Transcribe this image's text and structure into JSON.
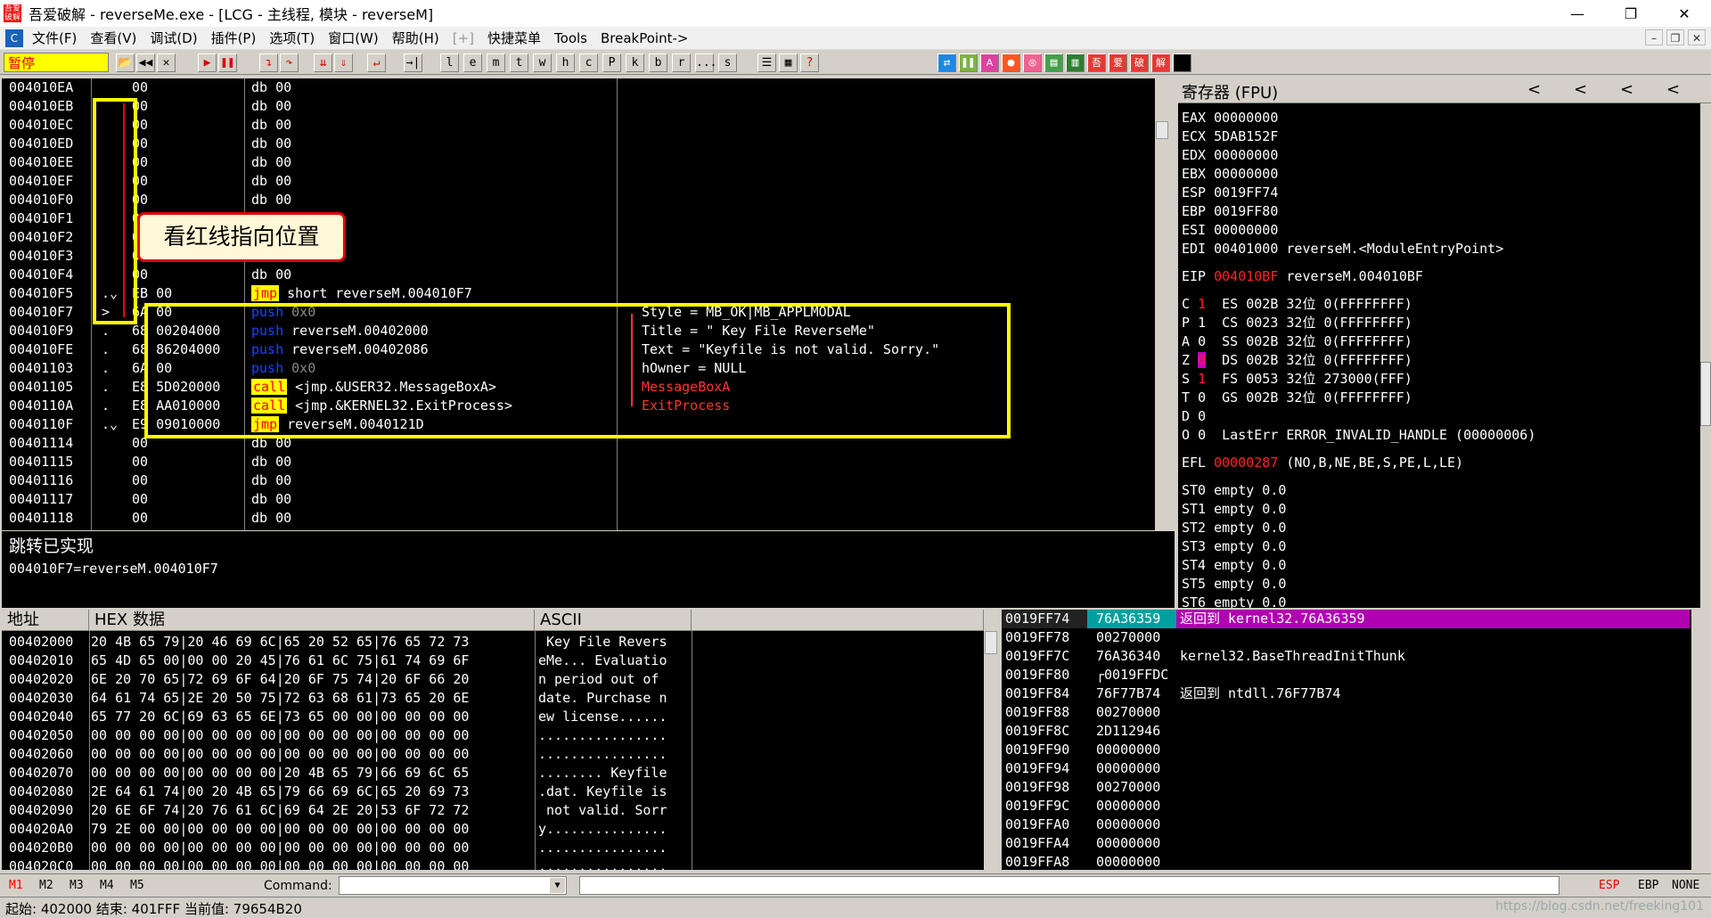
{
  "window": {
    "title": "吾爱破解 - reverseMe.exe - [LCG - 主线程, 模块 - reverseM]",
    "app_icon": "吾爱破解",
    "minimize": "—",
    "restore": "❐",
    "close": "✕"
  },
  "menu": {
    "items": [
      "文件(F)",
      "查看(V)",
      "调试(D)",
      "插件(P)",
      "选项(T)",
      "窗口(W)",
      "帮助(H)",
      "[+]",
      "快捷菜单",
      "Tools",
      "BreakPoint->"
    ]
  },
  "toolbar": {
    "status": "暂停",
    "letters": [
      "l",
      "e",
      "m",
      "t",
      "w",
      "h",
      "c",
      "P",
      "k",
      "b",
      "r",
      "...",
      "s"
    ],
    "right_icons": [
      "吾",
      "爱",
      "破",
      "解"
    ]
  },
  "cpu": {
    "rows": [
      {
        "addr": "004010EA",
        "mark": "",
        "hex": "00",
        "dis": "db 00",
        "com": ""
      },
      {
        "addr": "004010EB",
        "mark": "",
        "hex": "00",
        "dis": "db 00",
        "com": ""
      },
      {
        "addr": "004010EC",
        "mark": "",
        "hex": "00",
        "dis": "db 00",
        "com": ""
      },
      {
        "addr": "004010ED",
        "mark": "",
        "hex": "00",
        "dis": "db 00",
        "com": ""
      },
      {
        "addr": "004010EE",
        "mark": "",
        "hex": "00",
        "dis": "db 00",
        "com": ""
      },
      {
        "addr": "004010EF",
        "mark": "",
        "hex": "00",
        "dis": "db 00",
        "com": ""
      },
      {
        "addr": "004010F0",
        "mark": "",
        "hex": "00",
        "dis": "db 00",
        "com": ""
      },
      {
        "addr": "004010F1",
        "mark": "",
        "hex": "00",
        "dis": "db 00",
        "com": ""
      },
      {
        "addr": "004010F2",
        "mark": "",
        "hex": "00",
        "dis": "db 00",
        "com": ""
      },
      {
        "addr": "004010F3",
        "mark": "",
        "hex": "00",
        "dis": "db 00",
        "com": ""
      },
      {
        "addr": "004010F4",
        "mark": "",
        "hex": "00",
        "dis": "db 00",
        "com": ""
      },
      {
        "addr": "004010F5",
        "mark": ".⌄",
        "hex": "EB 00",
        "kw": "jmp",
        "operand": "short reverseM.004010F7",
        "com": ""
      },
      {
        "addr": "004010F7",
        "mark": ">",
        "hex": "6A 00",
        "kwb": "push",
        "operand": "0x0",
        "dim": true,
        "com": "Style = MB_OK|MB_APPLMODAL"
      },
      {
        "addr": "004010F9",
        "mark": ".",
        "hex": "68 00204000",
        "kwb": "push",
        "operand": "reverseM.00402000",
        "com": "Title = \" Key File ReverseMe\""
      },
      {
        "addr": "004010FE",
        "mark": ".",
        "hex": "68 86204000",
        "kwb": "push",
        "operand": "reverseM.00402086",
        "com": "Text = \"Keyfile is not valid. Sorry.\""
      },
      {
        "addr": "00401103",
        "mark": ".",
        "hex": "6A 00",
        "kwb": "push",
        "operand": "0x0",
        "dim": true,
        "com": "hOwner = NULL"
      },
      {
        "addr": "00401105",
        "mark": ".",
        "hex": "E8 5D020000",
        "kw": "call",
        "operand": "<jmp.&USER32.MessageBoxA>",
        "com": "MessageBoxA",
        "com_red": true
      },
      {
        "addr": "0040110A",
        "mark": ".",
        "hex": "E8 AA010000",
        "kw": "call",
        "operand": "<jmp.&KERNEL32.ExitProcess>",
        "com": "ExitProcess",
        "com_red": true
      },
      {
        "addr": "0040110F",
        "mark": ".⌄",
        "hex": "E9 09010000",
        "kw": "jmp",
        "operand": "reverseM.0040121D",
        "com": ""
      },
      {
        "addr": "00401114",
        "mark": "",
        "hex": "00",
        "dis": "db 00",
        "com": ""
      },
      {
        "addr": "00401115",
        "mark": "",
        "hex": "00",
        "dis": "db 00",
        "com": ""
      },
      {
        "addr": "00401116",
        "mark": "",
        "hex": "00",
        "dis": "db 00",
        "com": ""
      },
      {
        "addr": "00401117",
        "mark": "",
        "hex": "00",
        "dis": "db 00",
        "com": ""
      },
      {
        "addr": "00401118",
        "mark": "",
        "hex": "00",
        "dis": "db 00",
        "com": ""
      }
    ]
  },
  "callout": "看红线指向位置",
  "info": {
    "title": "跳转已实现",
    "detail": "004010F7=reverseM.004010F7"
  },
  "registers": {
    "header": "寄存器 (FPU)",
    "arrows": [
      "<",
      "<",
      "<",
      "<"
    ],
    "gp": [
      "EAX 00000000",
      "ECX 5DAB152F",
      "EDX 00000000",
      "EBX 00000000",
      "ESP 0019FF74",
      "EBP 0019FF80",
      "ESI 00000000",
      "EDI 00401000 reverseM.<ModuleEntryPoint>"
    ],
    "eip_label": "EIP",
    "eip_value": "004010BF",
    "eip_comment": "reverseM.004010BF",
    "flags": [
      {
        "f": "C",
        "v": "1",
        "red": true,
        "seg": "ES 002B 32位 0(FFFFFFFF)"
      },
      {
        "f": "P",
        "v": "1",
        "red": false,
        "seg": "CS 0023 32位 0(FFFFFFFF)"
      },
      {
        "f": "A",
        "v": "0",
        "red": false,
        "seg": "SS 002B 32位 0(FFFFFFFF)"
      },
      {
        "f": "Z",
        "v": "0",
        "red": true,
        "zf": true,
        "seg": "DS 002B 32位 0(FFFFFFFF)"
      },
      {
        "f": "S",
        "v": "1",
        "red": true,
        "seg": "FS 0053 32位 273000(FFF)"
      },
      {
        "f": "T",
        "v": "0",
        "red": false,
        "seg": "GS 002B 32位 0(FFFFFFFF)"
      },
      {
        "f": "D",
        "v": "0",
        "red": false,
        "seg": ""
      },
      {
        "f": "O",
        "v": "0",
        "red": false,
        "seg": "LastErr ERROR_INVALID_HANDLE (00000006)"
      }
    ],
    "efl_label": "EFL",
    "efl_value": "00000287",
    "efl_comment": "(NO,B,NE,BE,S,PE,L,LE)",
    "fpu": [
      "ST0 empty 0.0",
      "ST1 empty 0.0",
      "ST2 empty 0.0",
      "ST3 empty 0.0",
      "ST4 empty 0.0",
      "ST5 empty 0.0",
      "ST6 empty 0.0"
    ]
  },
  "dump": {
    "col_addr": "地址",
    "col_hex": "HEX 数据",
    "col_ascii": "ASCII",
    "rows": [
      {
        "a": "00402000",
        "h": "20 4B 65 79|20 46 69 6C|65 20 52 65|76 65 72 73",
        "s": " Key File Revers"
      },
      {
        "a": "00402010",
        "h": "65 4D 65 00|00 00 20 45|76 61 6C 75|61 74 69 6F",
        "s": "eMe... Evaluatio"
      },
      {
        "a": "00402020",
        "h": "6E 20 70 65|72 69 6F 64|20 6F 75 74|20 6F 66 20",
        "s": "n period out of "
      },
      {
        "a": "00402030",
        "h": "64 61 74 65|2E 20 50 75|72 63 68 61|73 65 20 6E",
        "s": "date. Purchase n"
      },
      {
        "a": "00402040",
        "h": "65 77 20 6C|69 63 65 6E|73 65 00 00|00 00 00 00",
        "s": "ew license......"
      },
      {
        "a": "00402050",
        "h": "00 00 00 00|00 00 00 00|00 00 00 00|00 00 00 00",
        "s": "................"
      },
      {
        "a": "00402060",
        "h": "00 00 00 00|00 00 00 00|00 00 00 00|00 00 00 00",
        "s": "................"
      },
      {
        "a": "00402070",
        "h": "00 00 00 00|00 00 00 00|20 4B 65 79|66 69 6C 65",
        "s": "........ Keyfile"
      },
      {
        "a": "00402080",
        "h": "2E 64 61 74|00 20 4B 65|79 66 69 6C|65 20 69 73",
        "s": ".dat. Keyfile is"
      },
      {
        "a": "00402090",
        "h": "20 6E 6F 74|20 76 61 6C|69 64 2E 20|53 6F 72 72",
        "s": " not valid. Sorr"
      },
      {
        "a": "004020A0",
        "h": "79 2E 00 00|00 00 00 00|00 00 00 00|00 00 00 00",
        "s": "y..............."
      },
      {
        "a": "004020B0",
        "h": "00 00 00 00|00 00 00 00|00 00 00 00|00 00 00 00",
        "s": "................"
      },
      {
        "a": "004020C0",
        "h": "00 00 00 00|00 00 00 00|00 00 00 00|00 00 00 00",
        "s": "................"
      }
    ]
  },
  "stack": {
    "rows": [
      {
        "a": "0019FF74",
        "v": "76A36359"
      },
      {
        "a": "0019FF78",
        "v": "00270000"
      },
      {
        "a": "0019FF7C",
        "v": "76A36340"
      },
      {
        "a": "0019FF80",
        "v": "┌0019FFDC"
      },
      {
        "a": "0019FF84",
        "v": "76F77B74"
      },
      {
        "a": "0019FF88",
        "v": "00270000"
      },
      {
        "a": "0019FF8C",
        "v": "2D112946"
      },
      {
        "a": "0019FF90",
        "v": "00000000"
      },
      {
        "a": "0019FF94",
        "v": "00000000"
      },
      {
        "a": "0019FF98",
        "v": "00270000"
      },
      {
        "a": "0019FF9C",
        "v": "00000000"
      },
      {
        "a": "0019FFA0",
        "v": "00000000"
      },
      {
        "a": "0019FFA4",
        "v": "00000000"
      },
      {
        "a": "0019FFA8",
        "v": "00000000"
      }
    ]
  },
  "stack_comments": {
    "c0": "返回到 kernel32.76A36359",
    "c2": "kernel32.BaseThreadInitThunk",
    "c4": "返回到 ntdll.76F77B74"
  },
  "cmdbar": {
    "m": [
      "M1",
      "M2",
      "M3",
      "M4",
      "M5"
    ],
    "label": "Command:",
    "right": [
      "ESP",
      "EBP",
      "NONE"
    ]
  },
  "statusbar": {
    "text": "起始: 402000 结束: 401FFF 当前值: 79654B20",
    "watermark": "https://blog.csdn.net/freeking101"
  }
}
